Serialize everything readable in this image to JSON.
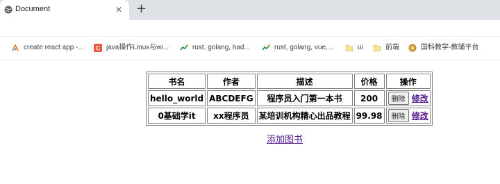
{
  "tab": {
    "title": "Document",
    "icon": "globe-icon",
    "close": "✕"
  },
  "new_tab": "+",
  "bookmarks": [
    {
      "label": "create react app -...",
      "icon": "react-icon"
    },
    {
      "label": "java操作Linux与wi...",
      "icon": "csdn-icon"
    },
    {
      "label": "rust, golang, had...",
      "icon": "trend-icon"
    },
    {
      "label": "rust, golang, vue,...",
      "icon": "trend-icon"
    },
    {
      "label": "ui",
      "icon": "folder-icon"
    },
    {
      "label": "前端",
      "icon": "folder-icon"
    },
    {
      "label": "国科教学-教辅平台",
      "icon": "gk-icon"
    }
  ],
  "table": {
    "headers": [
      "书名",
      "作者",
      "描述",
      "价格",
      "操作"
    ],
    "rows": [
      {
        "name": "hello_world",
        "author": "ABCDEFG",
        "desc": "程序员入门第一本书",
        "price": "200",
        "delete": "删除",
        "edit": "修改"
      },
      {
        "name": "0基础学it",
        "author": "xx程序员",
        "desc": "某培训机构精心出品教程",
        "price": "99.98",
        "delete": "删除",
        "edit": "修改"
      }
    ]
  },
  "add_link": "添加图书",
  "colors": {
    "tabstrip": "#dee1e6",
    "link_visited": "#551a8b"
  }
}
